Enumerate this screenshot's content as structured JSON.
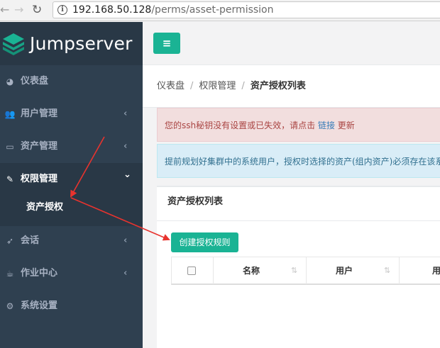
{
  "browser": {
    "back_icon": "back-arrow-icon",
    "forward_icon": "forward-arrow-icon",
    "reload_icon": "reload-icon",
    "url_host": "192.168.50.128",
    "url_path": "/perms/asset-permission"
  },
  "sidebar": {
    "logo_text": "Jumpserver",
    "items": [
      {
        "label": "仪表盘",
        "icon": "dashboard-icon",
        "chevron": ""
      },
      {
        "label": "用户管理",
        "icon": "users-icon",
        "chevron": "‹"
      },
      {
        "label": "资产管理",
        "icon": "inbox-icon",
        "chevron": "‹"
      },
      {
        "label": "权限管理",
        "icon": "edit-icon",
        "chevron": "⌄"
      },
      {
        "label": "会话",
        "icon": "rocket-icon",
        "chevron": "‹"
      },
      {
        "label": "作业中心",
        "icon": "coffee-icon",
        "chevron": "‹"
      },
      {
        "label": "系统设置",
        "icon": "gears-icon",
        "chevron": ""
      }
    ],
    "sub_item": "资产授权"
  },
  "topbar": {
    "menu_icon": "≡"
  },
  "breadcrumb": {
    "items": [
      "仪表盘",
      "权限管理",
      "资产授权列表"
    ],
    "separator": "/"
  },
  "alerts": {
    "danger_text": "您的ssh秘钥没有设置或已失效，请点击",
    "danger_link": "链接",
    "danger_tail": "更新",
    "info_text": "提前规划好集群中的系统用户，授权时选择的资产(组内资产)必须存在该系"
  },
  "panel": {
    "title": "资产授权列表",
    "create_button": "创建授权规则",
    "columns": [
      "名称",
      "用户",
      "用"
    ],
    "sort_icon": "⇅"
  },
  "colors": {
    "sidebar_bg": "#2f4050",
    "accent": "#1ab394",
    "annotation": "#e8332e"
  }
}
